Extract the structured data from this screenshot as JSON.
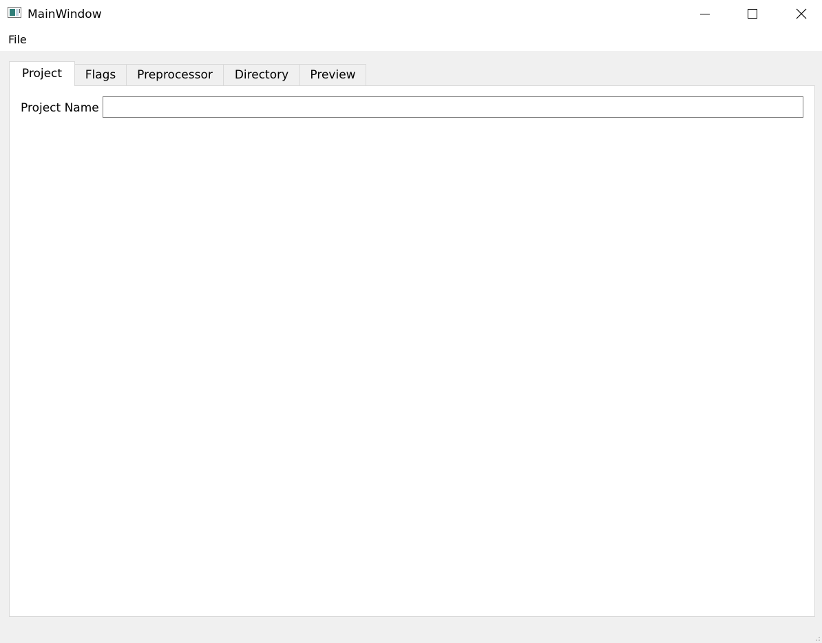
{
  "window": {
    "title": "MainWindow",
    "icon": "app-window-icon"
  },
  "titlebar_buttons": {
    "minimize_icon": "minimize-icon",
    "maximize_icon": "maximize-icon",
    "close_icon": "close-icon"
  },
  "menubar": {
    "items": [
      {
        "label": "File"
      }
    ]
  },
  "tabs": {
    "active_index": 0,
    "items": [
      {
        "label": "Project"
      },
      {
        "label": "Flags"
      },
      {
        "label": "Preprocessor"
      },
      {
        "label": "Directory"
      },
      {
        "label": "Preview"
      }
    ]
  },
  "project_tab": {
    "project_name_label": "Project Name",
    "project_name_value": "",
    "project_name_placeholder": ""
  },
  "colors": {
    "window_background": "#f0f0f0",
    "panel_background": "#ffffff",
    "border": "#d9d9d9",
    "input_border": "#7a7a7a",
    "icon_accent": "#2f7e78"
  }
}
